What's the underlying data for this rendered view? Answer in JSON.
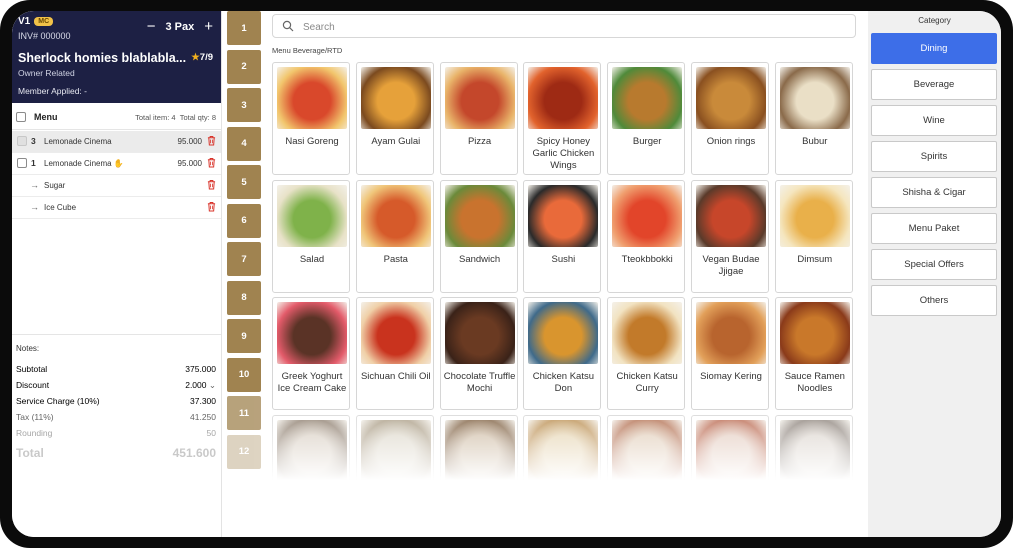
{
  "header": {
    "table_code": "V1",
    "badge": "MC",
    "invoice": "INV# 000000",
    "pax_label": "3 Pax",
    "minus": "−",
    "plus": "+",
    "customer_name": "Sherlock homies blablabla...",
    "rating": "7/9",
    "relation": "Owner Related",
    "member": "Member Applied: -"
  },
  "order": {
    "menu_label": "Menu",
    "total_items": "Total item: 4",
    "total_qty": "Total qty: 8",
    "rows": [
      {
        "qty": "3",
        "name": "Lemonade Cinema",
        "price": "95.000"
      },
      {
        "qty": "1",
        "name": "Lemonade Cinema",
        "price": "95.000"
      }
    ],
    "modifiers": [
      {
        "name": "Sugar"
      },
      {
        "name": "Ice Cube"
      }
    ],
    "arrow": "→",
    "notes_label": "Notes:"
  },
  "summary": {
    "subtotal_label": "Subtotal",
    "subtotal": "375.000",
    "discount_label": "Discount",
    "discount": "2.000",
    "service_label": "Service Charge (10%)",
    "service": "37.300",
    "tax_label": "Tax (11%)",
    "tax": "41.250",
    "rounding_label": "Rounding",
    "rounding": "50",
    "total_label": "Total",
    "total": "451.600"
  },
  "tables": [
    "1",
    "2",
    "3",
    "4",
    "5",
    "6",
    "7",
    "8",
    "9",
    "10",
    "11",
    "12"
  ],
  "search": {
    "placeholder": "Search"
  },
  "breadcrumb": "Menu Beverage/RTD",
  "menu_items": [
    {
      "name": "Nasi Goreng",
      "colors": [
        "#d9482b",
        "#f2c66d"
      ]
    },
    {
      "name": "Ayam Gulai",
      "colors": [
        "#e6a13a",
        "#7b4a1f"
      ]
    },
    {
      "name": "Pizza",
      "colors": [
        "#c4472b",
        "#e9b46a"
      ]
    },
    {
      "name": "Spicy Honey Garlic Chicken Wings",
      "colors": [
        "#9e2a14",
        "#e2632d"
      ]
    },
    {
      "name": "Burger",
      "colors": [
        "#b87a2e",
        "#4f8a3a"
      ]
    },
    {
      "name": "Onion rings",
      "colors": [
        "#c98a3a",
        "#8a5020"
      ]
    },
    {
      "name": "Bubur",
      "colors": [
        "#eadfc6",
        "#8a6a4a"
      ]
    },
    {
      "name": "Salad",
      "colors": [
        "#7fb24a",
        "#e8e2c8"
      ]
    },
    {
      "name": "Pasta",
      "colors": [
        "#d65a2a",
        "#f0c67a"
      ]
    },
    {
      "name": "Sandwich",
      "colors": [
        "#c9732e",
        "#6b8a3a"
      ]
    },
    {
      "name": "Sushi",
      "colors": [
        "#e96a3a",
        "#2a2a2a"
      ]
    },
    {
      "name": "Tteokbbokki",
      "colors": [
        "#e2452a",
        "#f0a070"
      ]
    },
    {
      "name": "Vegan Budae Jjigae",
      "colors": [
        "#c7462a",
        "#5a3a2a"
      ]
    },
    {
      "name": "Dimsum",
      "colors": [
        "#e9b04a",
        "#f5e6bf"
      ]
    },
    {
      "name": "Greek Yoghurt Ice Cream Cake",
      "colors": [
        "#5a3326",
        "#e35b6a"
      ]
    },
    {
      "name": "Sichuan Chili Oil",
      "colors": [
        "#c9331e",
        "#f0d0a8"
      ]
    },
    {
      "name": "Chocolate Truffle Mochi",
      "colors": [
        "#6a3a22",
        "#3a2218"
      ]
    },
    {
      "name": "Chicken Katsu Don",
      "colors": [
        "#d9952e",
        "#3f6a8a"
      ]
    },
    {
      "name": "Chicken Katsu Curry",
      "colors": [
        "#c27a2a",
        "#f2e3c2"
      ]
    },
    {
      "name": "Siomay Kering",
      "colors": [
        "#b8642e",
        "#e2a05a"
      ]
    },
    {
      "name": "Sauce Ramen Noodles",
      "colors": [
        "#c9782a",
        "#8a3a1a"
      ]
    },
    {
      "name": "",
      "colors": [
        "#d4c9bb",
        "#8a7a6a"
      ]
    },
    {
      "name": "",
      "colors": [
        "#d9d3c4",
        "#a89a82"
      ]
    },
    {
      "name": "",
      "colors": [
        "#c9b49a",
        "#7a5a3a"
      ]
    },
    {
      "name": "",
      "colors": [
        "#e2cfa8",
        "#b88a4a"
      ]
    },
    {
      "name": "",
      "colors": [
        "#ddc7b0",
        "#b06a4a"
      ]
    },
    {
      "name": "",
      "colors": [
        "#e0c6b8",
        "#b8644a"
      ]
    },
    {
      "name": "",
      "colors": [
        "#d8d0c8",
        "#8a8078"
      ]
    }
  ],
  "category": {
    "title": "Category",
    "items": [
      "Dining",
      "Beverage",
      "Wine",
      "Spirits",
      "Shisha & Cigar",
      "Menu Paket",
      "Special Offers",
      "Others"
    ],
    "active_color": "#3d6ee8"
  },
  "colors": {
    "header_bg": "#1d2044",
    "table_button": "#a08350",
    "delete": "#d9342b"
  }
}
